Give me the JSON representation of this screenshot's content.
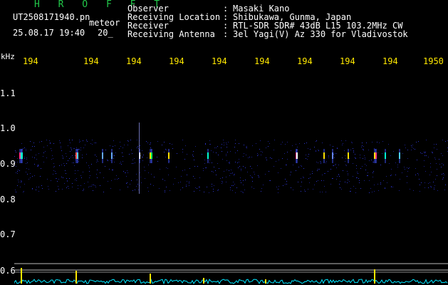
{
  "app": {
    "title": "H R O F F T",
    "file_name": "UT2508171940.pn",
    "meteor_label": "meteor",
    "datetime": "25.08.17 19:40",
    "minute_label": "20_"
  },
  "info": [
    {
      "label": "Observer",
      "value": "Masaki Kano"
    },
    {
      "label": "Receiving Location",
      "value": "Shibukawa, Gunma, Japan"
    },
    {
      "label": "Receiver",
      "value": "RTL-SDR SDR# 43dB L15 103.2MHz CW"
    },
    {
      "label": "Receiving Antenna",
      "value": "3el Yagi(V) Az 330 for Vladivostok"
    }
  ],
  "axes": {
    "y_unit": "kHz",
    "y_ticks": [
      {
        "label": "1.1",
        "value": 1.1
      },
      {
        "label": "1.0",
        "value": 1.0
      },
      {
        "label": "0.9",
        "value": 0.9
      },
      {
        "label": "0.8",
        "value": 0.8
      },
      {
        "label": "0.7",
        "value": 0.7
      },
      {
        "label": "0.6",
        "value": 0.6
      }
    ],
    "x_ticks": [
      "194",
      "194",
      "194",
      "194",
      "194",
      "194",
      "194",
      "194",
      "194",
      "1950"
    ]
  },
  "colors": {
    "background": "#000000",
    "title_green": "#22c84a",
    "tick_yellow": "#ffe800",
    "text_white": "#ffffff",
    "trace_cyan": "#00e5ff",
    "signal_band": "#1b1f8a"
  }
}
